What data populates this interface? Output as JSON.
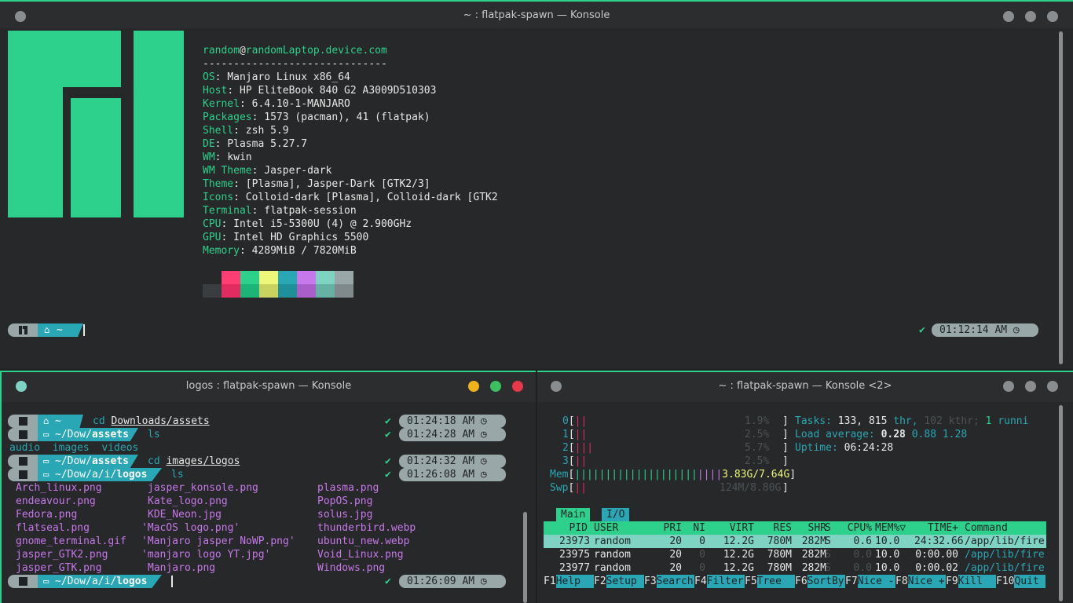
{
  "colors": {
    "accent": "#2ed18b",
    "teal": "#2aa7b4",
    "purple": "#c778ea"
  },
  "win1": {
    "title": "~ : flatpak-spawn — Konsole",
    "neofetch": {
      "user_host": "random@randomLaptop.device.com",
      "separator": "------------------------------",
      "rows": [
        {
          "key": "OS",
          "val": "Manjaro Linux x86_64"
        },
        {
          "key": "Host",
          "val": "HP EliteBook 840 G2 A3009D510303"
        },
        {
          "key": "Kernel",
          "val": "6.4.10-1-MANJARO"
        },
        {
          "key": "Packages",
          "val": "1573 (pacman), 41 (flatpak)"
        },
        {
          "key": "Shell",
          "val": "zsh 5.9"
        },
        {
          "key": "DE",
          "val": "Plasma 5.27.7"
        },
        {
          "key": "WM",
          "val": "kwin"
        },
        {
          "key": "WM Theme",
          "val": "Jasper-dark"
        },
        {
          "key": "Theme",
          "val": "[Plasma], Jasper-Dark [GTK2/3]"
        },
        {
          "key": "Icons",
          "val": "Colloid-dark [Plasma], Colloid-dark [GTK2"
        },
        {
          "key": "Terminal",
          "val": "flatpak-session"
        },
        {
          "key": "CPU",
          "val": "Intel i5-5300U (4) @ 2.900GHz"
        },
        {
          "key": "GPU",
          "val": "Intel HD Graphics 5500"
        },
        {
          "key": "Memory",
          "val": "4289MiB / 7820MiB"
        }
      ],
      "palette_top": [
        "#262829",
        "#ff3f73",
        "#2ed18b",
        "#eef77a",
        "#2aa7b4",
        "#c778ea",
        "#7fd3c3",
        "#9aa7a9"
      ],
      "palette_bottom": [
        "#3a3d3f",
        "#e22b60",
        "#1fb477",
        "#c9d15f",
        "#1f8f9a",
        "#a95ec9",
        "#65b1a4",
        "#808a8c"
      ]
    },
    "prompt": {
      "home": "~",
      "check": "✔",
      "time": "01:12:14 AM"
    }
  },
  "win2": {
    "title": "logos : flatpak-spawn — Konsole",
    "history": [
      {
        "path_pre": "~",
        "path_bold": "",
        "cmd": "cd",
        "arg": "Downloads/assets",
        "time": "01:24:18 AM"
      },
      {
        "path_pre": "~/Dow/",
        "path_bold": "assets",
        "cmd": "ls",
        "arg": "",
        "time": "01:24:28 AM"
      },
      {
        "path_pre": "~/Dow/",
        "path_bold": "assets",
        "cmd": "cd",
        "arg": "images/logos",
        "time": "01:24:32 AM"
      },
      {
        "path_pre": "~/Dow/a/i/",
        "path_bold": "logos",
        "cmd": "ls",
        "arg": "",
        "time": "01:26:08 AM"
      }
    ],
    "ls_dirs": "audio  images  videos",
    "files": [
      [
        "Arch_linux.png",
        "jasper_konsole.png",
        "plasma.png"
      ],
      [
        "endeavour.png",
        "Kate_logo.png",
        "PopOS.png"
      ],
      [
        "Fedora.png",
        "KDE_Neon.jpg",
        "solus.jpg"
      ],
      [
        "flatseal.png",
        "'MacOS logo.png'",
        "thunderbird.webp"
      ],
      [
        "gnome_terminal.gif",
        "'Manjaro jasper NoWP.png'",
        "ubuntu_new.webp"
      ],
      [
        "jasper_GTK2.png",
        "'manjaro logo YT.jpg'",
        "Void_Linux.png"
      ],
      [
        "jasper_GTK.png",
        "Manjaro.png",
        "Windows.png"
      ]
    ],
    "prompt": {
      "path_pre": "~/Dow/a/i/",
      "path_bold": "logos",
      "check": "✔",
      "time": "01:26:09 AM"
    }
  },
  "win3": {
    "title": "~ : flatpak-spawn — Konsole <2>",
    "cpus": [
      {
        "id": "0",
        "bars": "||",
        "pct": "1.9%"
      },
      {
        "id": "1",
        "bars": "||",
        "pct": "2.5%"
      },
      {
        "id": "2",
        "bars": "|||",
        "pct": "5.7%"
      },
      {
        "id": "3",
        "bars": "||",
        "pct": "2.5%"
      }
    ],
    "mem": {
      "label": "Mem",
      "bars": "||||||||||||||||||||",
      "val": "3.83G/7.64G"
    },
    "swp": {
      "label": "Swp",
      "bars": "||",
      "val": "124M/8.80G"
    },
    "tasks": {
      "label": "Tasks:",
      "count": "133,",
      "thr": "815",
      "thr_label": "thr,",
      "kthr": "102 kthr;",
      "running": "1",
      "running_label": "runni"
    },
    "load": {
      "label": "Load average:",
      "v1": "0.28",
      "v2": "0.88",
      "v3": "1.28"
    },
    "uptime": {
      "label": "Uptime:",
      "val": "06:24:28"
    },
    "tabs": [
      "Main",
      "I/O"
    ],
    "header": [
      "PID",
      "USER",
      "PRI",
      "NI",
      "VIRT",
      "RES",
      "SHR",
      "S",
      "CPU%",
      "MEM%▽",
      "TIME+",
      "Command"
    ],
    "rows": [
      [
        "23973",
        "random",
        "20",
        "0",
        "12.2G",
        "780M",
        "282M",
        "S",
        "0.6",
        "10.0",
        "24:32.66",
        "/app/lib/fire"
      ],
      [
        "23975",
        "random",
        "20",
        "0",
        "12.2G",
        "780M",
        "282M",
        "S",
        "0.0",
        "10.0",
        "0:00.00",
        "/app/lib/fire"
      ],
      [
        "23977",
        "random",
        "20",
        "0",
        "12.2G",
        "780M",
        "282M",
        "S",
        "0.0",
        "10.0",
        "0:00.02",
        "/app/lib/fire"
      ]
    ],
    "fkeys": [
      {
        "k": "F1",
        "l": "Help"
      },
      {
        "k": "F2",
        "l": "Setup"
      },
      {
        "k": "F3",
        "l": "Search"
      },
      {
        "k": "F4",
        "l": "Filter"
      },
      {
        "k": "F5",
        "l": "Tree"
      },
      {
        "k": "F6",
        "l": "SortBy"
      },
      {
        "k": "F7",
        "l": "Nice -"
      },
      {
        "k": "F8",
        "l": "Nice +"
      },
      {
        "k": "F9",
        "l": "Kill"
      },
      {
        "k": "F10",
        "l": "Quit"
      }
    ]
  }
}
